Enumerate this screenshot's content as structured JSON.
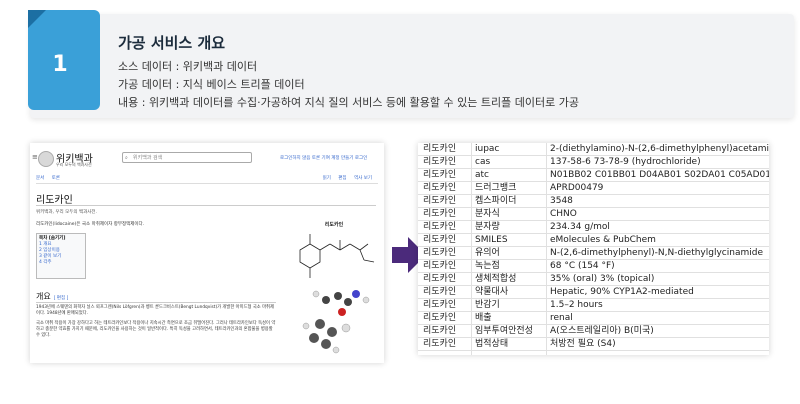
{
  "header": {
    "number": "1",
    "title": "가공 서비스 개요",
    "lines": [
      "소스 데이터 : 위키백과 데이터",
      "가공 데이터 : 지식 베이스 트리플 데이터",
      "내용 : 위키백과 데이터를 수집·가공하여 지식 질의 서비스 등에 활용할 수 있는 트리플 데이터로 가공"
    ]
  },
  "wiki": {
    "logo_name": "위키백과",
    "logo_sub": "우리 모두의 백과사전",
    "search_placeholder": "위키백과 검색",
    "top_links": "로그인하지 않음  토론  기여  계정 만들기  로그인",
    "tabs": [
      "문서",
      "토론"
    ],
    "tabs_right": [
      "읽기",
      "편집",
      "역사 보기"
    ],
    "article_title": "리도카인",
    "article_sub": "위키백과, 우리 모두의 백과사전.",
    "intro": "리도카인(lidocaine)은 국소 마취제이자 항부정맥제이다.",
    "toc_title": "목차 [숨기기]",
    "toc_items": [
      "1 개요",
      "2 임상이용",
      "3 같이 보기",
      "4 각주"
    ],
    "infobox_title": "리도카인",
    "section_title": "개요",
    "section_edit": "[ 편집 ]",
    "para1": "1943년에 스웨덴의 화학자 닐스 뢰프그렌(Nils Löfgren)과 벵트 룬드크비스트(Bengt Lundqvist)가 개발한 아미드형 국소 마취제이다. 1948년에 판매되었다.",
    "para2": "국소 마취 작용이 가장 강하다고 하는 테트라카인보다 작용이나 지속시간 측면으로 조금 뒤떨어진다. 그러나 테트라카인보다 독성이 약하고 충분한 약효를 가지기 때문에, 리도카인을 사용하는 것이 일반적이다. 특히 독성을 고려하면서, 테트라카인과의 혼합물을 병용할 수 있다."
  },
  "table": {
    "rows": [
      [
        "리도카인",
        "iupac",
        "2-(diethylamino)-N-(2,6-dimethylphenyl)acetamide"
      ],
      [
        "리도카인",
        "cas",
        "137-58-6  73-78-9 (hydrochloride)"
      ],
      [
        "리도카인",
        "atc",
        "N01BB02 C01BB01 D04AB01 S02DA01 C05AD01"
      ],
      [
        "리도카인",
        "드러그뱅크",
        "APRD00479"
      ],
      [
        "리도카인",
        "켐스파이더",
        "3548"
      ],
      [
        "리도카인",
        "분자식",
        "CHNO"
      ],
      [
        "리도카인",
        "분자량",
        "234.34 g/mol"
      ],
      [
        "리도카인",
        "SMILES",
        "eMolecules & PubChem"
      ],
      [
        "리도카인",
        "유의어",
        "N-(2,6-dimethylphenyl)-N,N-diethylglycinamide"
      ],
      [
        "리도카인",
        "녹는점",
        "68 °C (154 °F)"
      ],
      [
        "리도카인",
        "생체적합성",
        "35% (oral)  3% (topical)"
      ],
      [
        "리도카인",
        "약물대사",
        "Hepatic, 90% CYP1A2-mediated"
      ],
      [
        "리도카인",
        "반감기",
        "1.5–2 hours"
      ],
      [
        "리도카인",
        "배출",
        "renal"
      ],
      [
        "리도카인",
        "임부투여안전성",
        "A(오스트레일리아) B(미국)"
      ],
      [
        "리도카인",
        "법적상태",
        "처방전 필요 (S4)"
      ]
    ]
  },
  "colors": {
    "badge": "#3aa0d8",
    "arrow": "#4b2a7b"
  }
}
